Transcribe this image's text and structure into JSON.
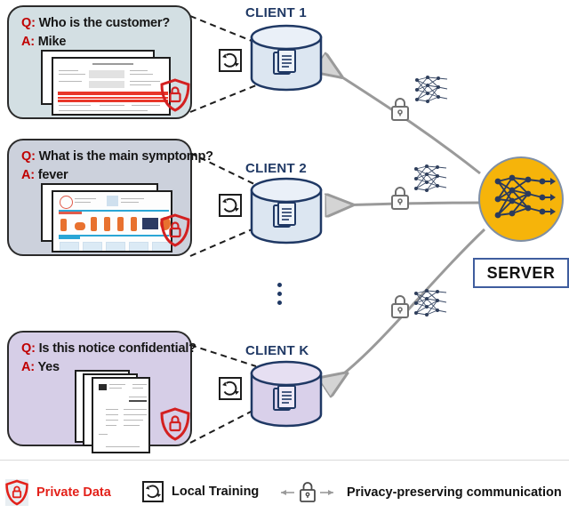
{
  "diagram": {
    "title": "Federated learning with privacy-preserving communication",
    "colors": {
      "client1_box_fill": "#d3dfe3",
      "client2_box_fill": "#ccd1dc",
      "clientk_box_fill": "#d6cee7",
      "client1_cylinder_fill": "#dce6f1",
      "client2_cylinder_fill": "#dce6f1",
      "clientk_cylinder_fill": "#d9d0ea",
      "cylinder_stroke": "#1f3864",
      "client_label": "#1f3864",
      "server_circle": "#f6b40a",
      "server_border": "#3f5d9e",
      "arrow": "#9a9a9a",
      "shield_red": "#d32020",
      "qa_label_red": "#c00000",
      "legend_red": "#e3211a",
      "dashed_line": "#1d1d1d"
    }
  },
  "clients": [
    {
      "id": "client-1",
      "label": "CLIENT 1",
      "question_label": "Q:",
      "question": "Who is the customer?",
      "answer_label": "A:",
      "answer": "Mike",
      "document_type": "invoice-form",
      "shield_icon": "shield-lock-icon",
      "training_icon": "refresh-icon",
      "database_icon": "documents-icon"
    },
    {
      "id": "client-2",
      "label": "CLIENT 2",
      "question_label": "Q:",
      "question": "What is the main symptomp?",
      "answer_label": "A:",
      "answer": "fever",
      "document_type": "medical-infographic",
      "shield_icon": "shield-lock-icon",
      "training_icon": "refresh-icon",
      "database_icon": "documents-icon"
    },
    {
      "id": "client-k",
      "label": "CLIENT K",
      "question_label": "Q:",
      "question": "Is this notice confidential?",
      "answer_label": "A:",
      "answer": "Yes",
      "document_type": "legal-notice",
      "shield_icon": "shield-lock-icon",
      "training_icon": "refresh-icon",
      "database_icon": "documents-icon"
    }
  ],
  "continuation": {
    "symbol": "vertical-ellipsis",
    "dots": 3
  },
  "server": {
    "label": "SERVER",
    "icon": "neural-network-icon"
  },
  "channels": [
    {
      "id": "channel-1",
      "lock_icon": "lock-icon",
      "payload_icon": "neural-network-icon"
    },
    {
      "id": "channel-2",
      "lock_icon": "lock-icon",
      "payload_icon": "neural-network-icon"
    },
    {
      "id": "channel-k",
      "lock_icon": "lock-icon",
      "payload_icon": "neural-network-icon"
    }
  ],
  "legend": {
    "items": [
      {
        "icon": "shield-lock-icon",
        "label": "Private Data"
      },
      {
        "icon": "refresh-icon",
        "label": "Local Training"
      },
      {
        "icon": "lock-arrows-icon",
        "label": "Privacy-preserving communication"
      }
    ]
  }
}
